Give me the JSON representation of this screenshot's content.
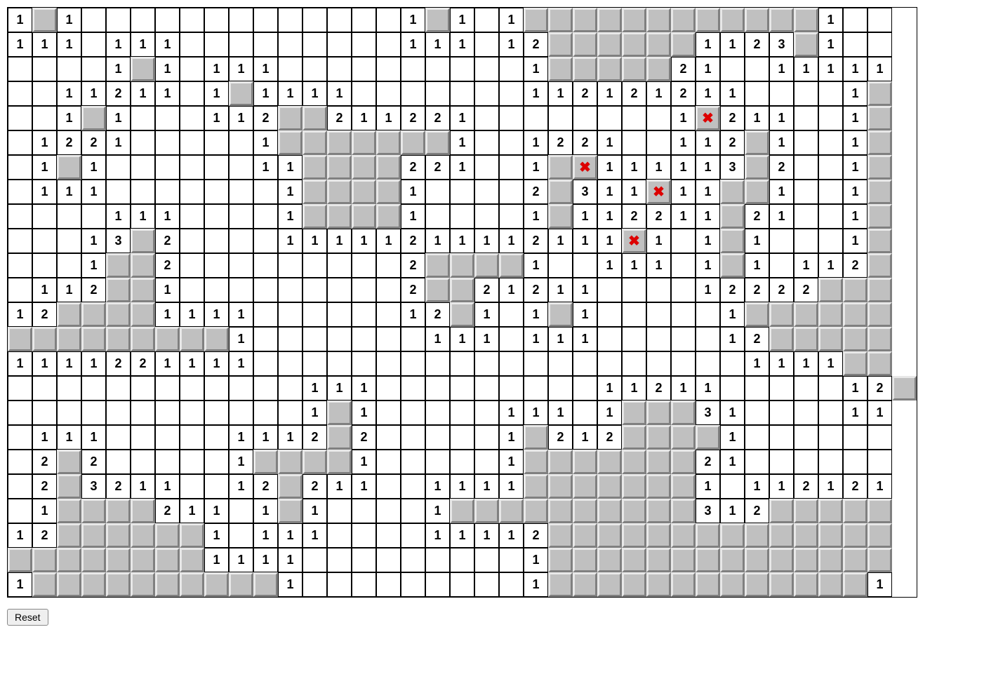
{
  "reset_label": "Reset",
  "cols": 36,
  "rows": 24,
  "grid": [
    [
      "1",
      "C",
      "1",
      "",
      "",
      "",
      "",
      "",
      "",
      "",
      "",
      "",
      "",
      "",
      "",
      "",
      "1",
      "C",
      "1",
      "",
      "1",
      "C",
      "C",
      "C",
      "C",
      "C",
      "C",
      "C",
      "C",
      "C",
      "C",
      "C",
      "C",
      "1",
      "",
      ""
    ],
    [
      "1",
      "1",
      "1",
      "",
      "1",
      "1",
      "1",
      "",
      "",
      "",
      "",
      "",
      "",
      "",
      "",
      "",
      "1",
      "1",
      "1",
      "",
      "1",
      "2",
      "C",
      "C",
      "C",
      "C",
      "C",
      "C",
      "1",
      "1",
      "2",
      "3",
      "C",
      "1",
      "",
      ""
    ],
    [
      "",
      "",
      "",
      "",
      "1",
      "C",
      "1",
      "",
      "1",
      "1",
      "1",
      "",
      "",
      "",
      "",
      "",
      "",
      "",
      "",
      "",
      "",
      "1",
      "C",
      "C",
      "C",
      "C",
      "C",
      "2",
      "1",
      "",
      "",
      "1",
      "1",
      "1",
      "1",
      "1"
    ],
    [
      "",
      "",
      "1",
      "1",
      "2",
      "1",
      "1",
      "",
      "1",
      "C",
      "1",
      "1",
      "1",
      "1",
      "",
      "",
      "",
      "",
      "",
      "",
      "",
      "1",
      "1",
      "2",
      "1",
      "2",
      "1",
      "2",
      "1",
      "1",
      "",
      "",
      "",
      "",
      "1",
      "C"
    ],
    [
      "",
      "",
      "1",
      "C",
      "1",
      "",
      "",
      "",
      "1",
      "1",
      "2",
      "C",
      "C",
      "2",
      "1",
      "1",
      "2",
      "2",
      "1",
      "",
      "",
      "",
      "",
      "",
      "",
      "",
      "",
      "1",
      "X",
      "2",
      "1",
      "1",
      "",
      "",
      "1",
      "C"
    ],
    [
      "",
      "1",
      "2",
      "2",
      "1",
      "",
      "",
      "",
      "",
      "",
      "1",
      "C",
      "C",
      "C",
      "C",
      "C",
      "C",
      "C",
      "1",
      "",
      "",
      "1",
      "2",
      "2",
      "1",
      "",
      "",
      "1",
      "1",
      "2",
      "C",
      "1",
      "",
      "",
      "1",
      "C"
    ],
    [
      "",
      "1",
      "C",
      "1",
      "",
      "",
      "",
      "",
      "",
      "",
      "1",
      "1",
      "C",
      "C",
      "C",
      "C",
      "2",
      "2",
      "1",
      "",
      "",
      "1",
      "C",
      "X",
      "1",
      "1",
      "1",
      "1",
      "1",
      "3",
      "C",
      "2",
      "",
      "",
      "1",
      "C"
    ],
    [
      "",
      "1",
      "1",
      "1",
      "",
      "",
      "",
      "",
      "",
      "",
      "",
      "1",
      "C",
      "C",
      "C",
      "C",
      "1",
      "",
      "",
      "",
      "",
      "2",
      "C",
      "3",
      "1",
      "1",
      "X",
      "1",
      "1",
      "C",
      "C",
      "1",
      "",
      "",
      "1",
      "C"
    ],
    [
      "",
      "",
      "",
      "",
      "1",
      "1",
      "1",
      "",
      "",
      "",
      "",
      "1",
      "C",
      "C",
      "C",
      "C",
      "1",
      "",
      "",
      "",
      "",
      "1",
      "C",
      "1",
      "1",
      "2",
      "2",
      "1",
      "1",
      "C",
      "2",
      "1",
      "",
      "",
      "1",
      "C"
    ],
    [
      "",
      "",
      "",
      "1",
      "3",
      "C",
      "2",
      "",
      "",
      "",
      "",
      "1",
      "1",
      "1",
      "1",
      "1",
      "2",
      "1",
      "1",
      "1",
      "1",
      "2",
      "1",
      "1",
      "1",
      "X",
      "1",
      "",
      "1",
      "C",
      "1",
      "",
      "",
      "",
      "1",
      "C"
    ],
    [
      "",
      "",
      "",
      "1",
      "C",
      "C",
      "2",
      "",
      "",
      "",
      "",
      "",
      "",
      "",
      "",
      "",
      "2",
      "C",
      "C",
      "C",
      "C",
      "1",
      "",
      "",
      "1",
      "1",
      "1",
      "",
      "1",
      "C",
      "1",
      "",
      "1",
      "1",
      "2",
      "C"
    ],
    [
      "",
      "1",
      "1",
      "2",
      "C",
      "C",
      "1",
      "",
      "",
      "",
      "",
      "",
      "",
      "",
      "",
      "",
      "2",
      "C",
      "C",
      "2",
      "1",
      "2",
      "1",
      "1",
      "",
      "",
      "",
      "",
      "1",
      "2",
      "2",
      "2",
      "2",
      "C",
      "C",
      "C"
    ],
    [
      "1",
      "2",
      "C",
      "C",
      "C",
      "C",
      "1",
      "1",
      "1",
      "1",
      "",
      "",
      "",
      "",
      "",
      "",
      "1",
      "2",
      "C",
      "1",
      "",
      "1",
      "C",
      "1",
      "",
      "",
      "",
      "",
      "",
      "1",
      "C",
      "C",
      "C",
      "C",
      "C",
      "C"
    ],
    [
      "C",
      "C",
      "C",
      "C",
      "C",
      "C",
      "C",
      "C",
      "C",
      "1",
      "",
      "",
      "",
      "",
      "",
      "",
      "",
      "1",
      "1",
      "1",
      "",
      "1",
      "1",
      "1",
      "",
      "",
      "",
      "",
      "",
      "1",
      "2",
      "C",
      "C",
      "C",
      "C",
      "C"
    ],
    [
      "1",
      "1",
      "1",
      "1",
      "2",
      "2",
      "1",
      "1",
      "1",
      "1",
      "",
      "",
      "",
      "",
      "",
      "",
      "",
      "",
      "",
      "",
      "",
      "",
      "",
      "",
      "",
      "",
      "",
      "",
      "",
      "",
      "1",
      "1",
      "1",
      "1",
      "C",
      "C"
    ],
    [
      "",
      "",
      "",
      "",
      "",
      "",
      "",
      "",
      "",
      "",
      "",
      "",
      "1",
      "1",
      "1",
      "",
      "",
      "",
      "",
      "",
      "",
      "",
      "",
      "",
      "1",
      "1",
      "2",
      "1",
      "1",
      "",
      "",
      "",
      "",
      "",
      "1",
      "2",
      "C"
    ],
    [
      "",
      "",
      "",
      "",
      "",
      "",
      "",
      "",
      "",
      "",
      "",
      "",
      "1",
      "C",
      "1",
      "",
      "",
      "",
      "",
      "",
      "1",
      "1",
      "1",
      "",
      "1",
      "C",
      "C",
      "C",
      "3",
      "1",
      "",
      "",
      "",
      "",
      "1",
      "1"
    ],
    [
      "",
      "1",
      "1",
      "1",
      "",
      "",
      "",
      "",
      "",
      "1",
      "1",
      "1",
      "2",
      "C",
      "2",
      "",
      "",
      "",
      "",
      "",
      "1",
      "C",
      "2",
      "1",
      "2",
      "C",
      "C",
      "C",
      "C",
      "1",
      "",
      "",
      "",
      "",
      "",
      ""
    ],
    [
      "",
      "2",
      "C",
      "2",
      "",
      "",
      "",
      "",
      "",
      "1",
      "C",
      "C",
      "C",
      "C",
      "1",
      "",
      "",
      "",
      "",
      "",
      "1",
      "C",
      "C",
      "C",
      "C",
      "C",
      "C",
      "C",
      "2",
      "1",
      "",
      "",
      "",
      "",
      "",
      ""
    ],
    [
      "",
      "2",
      "C",
      "3",
      "2",
      "1",
      "1",
      "",
      "",
      "1",
      "2",
      "C",
      "2",
      "1",
      "1",
      "",
      "",
      "1",
      "1",
      "1",
      "1",
      "C",
      "C",
      "C",
      "C",
      "C",
      "C",
      "C",
      "1",
      "",
      "1",
      "1",
      "2",
      "1",
      "2",
      "1"
    ],
    [
      "",
      "1",
      "C",
      "C",
      "C",
      "C",
      "2",
      "1",
      "1",
      "",
      "1",
      "C",
      "1",
      "",
      "",
      "",
      "",
      "1",
      "C",
      "C",
      "C",
      "C",
      "C",
      "C",
      "C",
      "C",
      "C",
      "C",
      "3",
      "1",
      "2",
      "C",
      "C",
      "C",
      "C",
      "C"
    ],
    [
      "1",
      "2",
      "C",
      "C",
      "C",
      "C",
      "C",
      "C",
      "1",
      "",
      "1",
      "1",
      "1",
      "",
      "",
      "",
      "",
      "1",
      "1",
      "1",
      "1",
      "2",
      "C",
      "C",
      "C",
      "C",
      "C",
      "C",
      "C",
      "C",
      "C",
      "C",
      "C",
      "C",
      "C",
      "C"
    ],
    [
      "C",
      "C",
      "C",
      "C",
      "C",
      "C",
      "C",
      "C",
      "1",
      "1",
      "1",
      "1",
      "",
      "",
      "",
      "",
      "",
      "",
      "",
      "",
      "",
      "1",
      "C",
      "C",
      "C",
      "C",
      "C",
      "C",
      "C",
      "C",
      "C",
      "C",
      "C",
      "C",
      "C",
      "C"
    ],
    [
      "1",
      "C",
      "C",
      "C",
      "C",
      "C",
      "C",
      "C",
      "C",
      "C",
      "C",
      "1",
      "",
      "",
      "",
      "",
      "",
      "",
      "",
      "",
      "",
      "1",
      "C",
      "C",
      "C",
      "C",
      "C",
      "C",
      "C",
      "C",
      "C",
      "C",
      "C",
      "C",
      "C",
      "1"
    ]
  ]
}
